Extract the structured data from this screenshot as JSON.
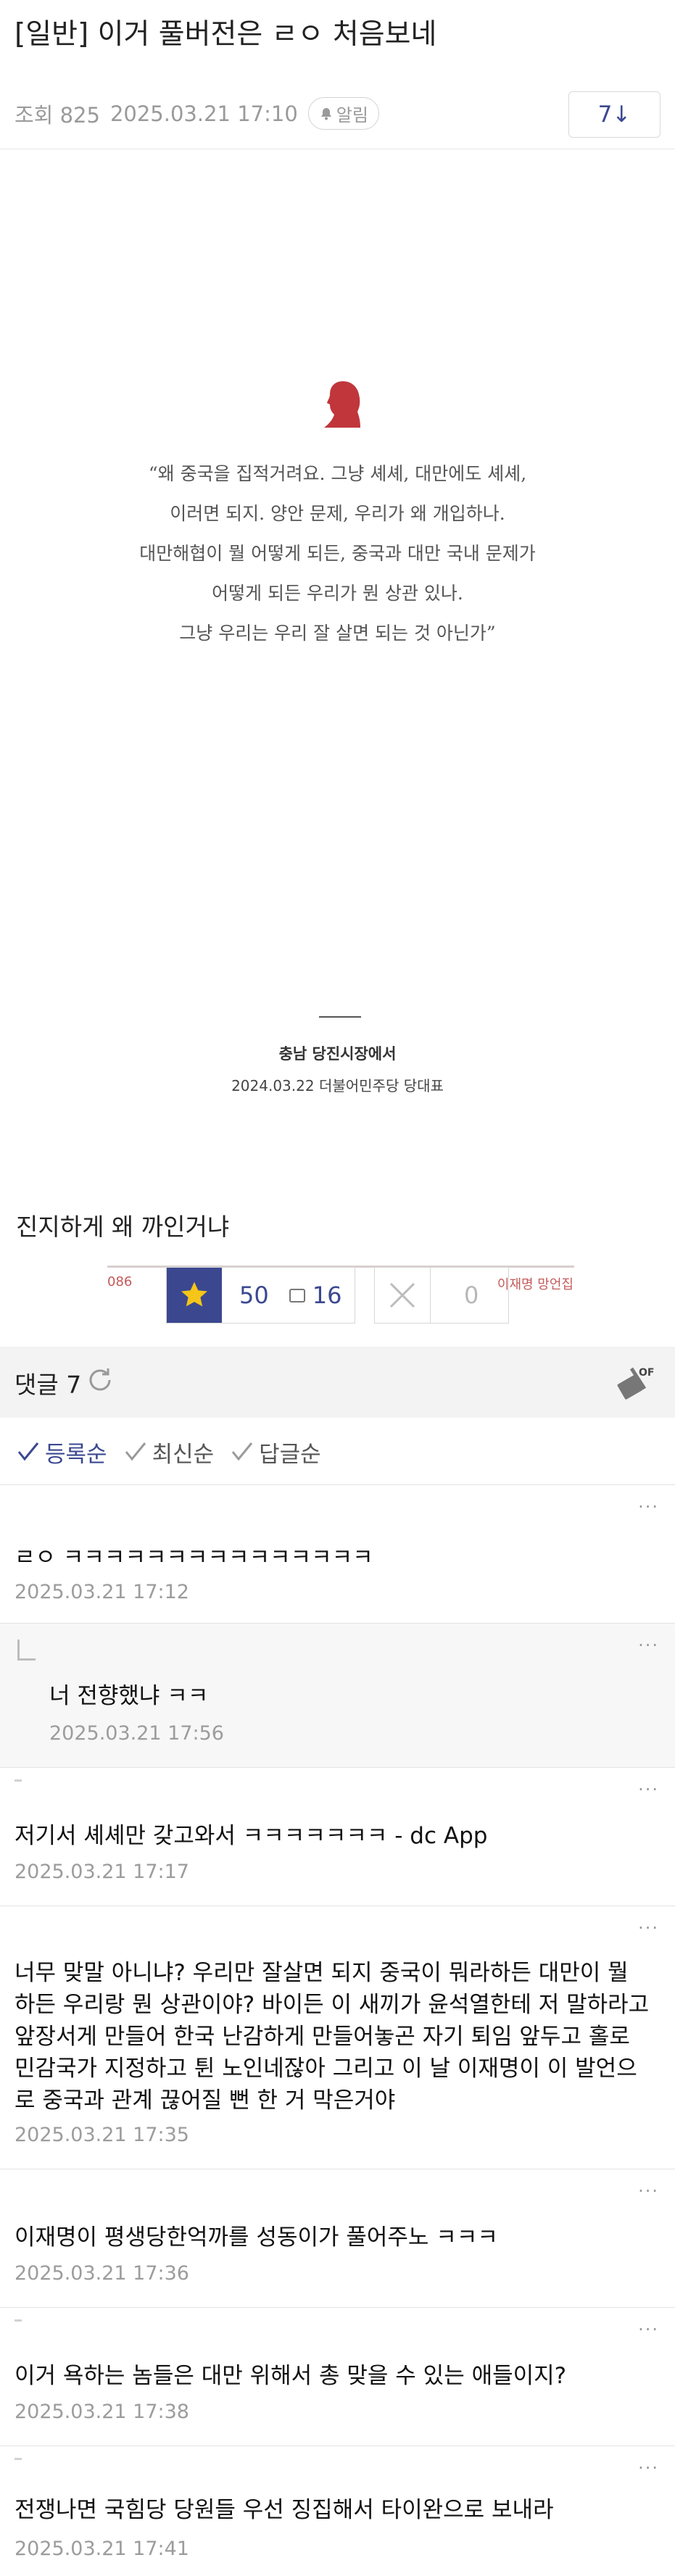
{
  "post": {
    "title": "[일반] 이거 풀버전은 ㄹㅇ 처음보네",
    "views_label": "조회 825",
    "datetime": "2025.03.21 17:10",
    "alarm_label": "알림",
    "comment_jump": "7↓"
  },
  "image": {
    "quote_lines": [
      "“왜 중국을 집적거려요. 그냥 셰셰, 대만에도 셰셰,",
      "이러면 되지. 양안 문제, 우리가 왜 개입하나.",
      "대만해협이 뭘 어떻게 되든, 중국과 대만 국내 문제가",
      "어떻게 되든 우리가 뭔 상관 있나.",
      "그냥 우리는 우리 잘 살면 되는 것 아닌가”"
    ],
    "place": "충남 당진시장에서",
    "dateline": "2024.03.22 더불어민주당 당대표",
    "page_number": "086",
    "book_name": "이재명 망언집",
    "accent_color": "#c0363b"
  },
  "caption": "진지하게 왜 까인거냐",
  "votes": {
    "up": "50",
    "fixed_up": "16",
    "down": "0",
    "accent_color": "#3b4890"
  },
  "comments_header": {
    "title": "댓글 7",
    "refresh_icon": "refresh-icon",
    "clean_icon": "clean-off-icon",
    "clean_label": "OFF"
  },
  "sort": {
    "options": [
      "등록순",
      "최신순",
      "답글순"
    ],
    "active": "등록순"
  },
  "comments": [
    {
      "text": "ㄹㅇ ㅋㅋㅋㅋㅋㅋㅋㅋㅋㅋㅋㅋㅋㅋㅋ",
      "date": "2025.03.21 17:12"
    },
    {
      "text": "너 전향했냐 ㅋㅋ",
      "date": "2025.03.21 17:56",
      "reply": true
    },
    {
      "text": "저기서 셰셰만 갖고와서 ㅋㅋㅋㅋㅋㅋㅋ - dc App",
      "date": "2025.03.21 17:17"
    },
    {
      "text": "너무 맞말 아니냐? 우리만 잘살면 되지 중국이 뭐라하든 대만이 뭘 하든 우리랑 뭔 상관이야? 바이든 이 새끼가 윤석열한테 저 말하라고 앞장서게 만들어 한국 난감하게 만들어놓곤 자기 퇴임 앞두고 홀로 민감국가 지정하고 튄 노인네잖아 그리고 이 날 이재명이 이 발언으로 중국과 관계 끊어질 뻔 한 거 막은거야",
      "date": "2025.03.21 17:35"
    },
    {
      "text": "이재명이 평생당한억까를 성동이가 풀어주노 ㅋㅋㅋ",
      "date": "2025.03.21 17:36"
    },
    {
      "text": "이거 욕하는 놈들은 대만 위해서 총 맞을 수 있는 애들이지?",
      "date": "2025.03.21 17:38"
    },
    {
      "text": "전쟁나면 국힘당 당원들 우선 징집해서 타이완으로 보내라",
      "date": "2025.03.21 17:41"
    }
  ]
}
